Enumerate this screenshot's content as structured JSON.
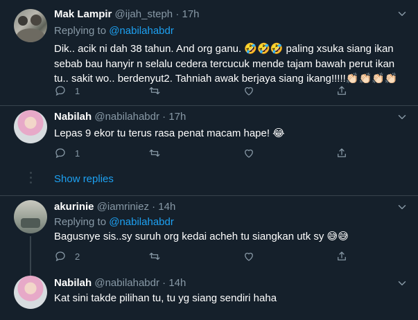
{
  "tweets": [
    {
      "name": "Mak Lampir",
      "handle": "@ijah_steph",
      "time": "· 17h",
      "replying_prefix": "Replying to ",
      "replying_handle": "@nabilahabdr",
      "text_lines": [
        "Dik.. acik ni dah 38 tahun. And org ganu. 🤣🤣🤣 paling xsuka siang ikan",
        "sebab bau hanyir n selalu cedera tercucuk mende tajam bawah perut ikan",
        "tu.. sakit wo.. berdenyut2. Tahniah awak berjaya siang ikang!!!!!👏🏻👏🏻👏🏻👏🏻"
      ],
      "reply_count": "1",
      "retweet_count": "",
      "like_count": ""
    },
    {
      "name": "Nabilah",
      "handle": "@nabilahabdr",
      "time": "· 17h",
      "text_lines": [
        "Lepas 9 ekor tu terus rasa penat macam hape! 😂"
      ],
      "reply_count": "1",
      "retweet_count": "",
      "like_count": ""
    },
    {
      "name": "akurinie",
      "handle": "@iamriniez",
      "time": "· 14h",
      "replying_prefix": "Replying to ",
      "replying_handle": "@nabilahabdr",
      "text_lines": [
        "Bagusnye sis..sy suruh org kedai acheh tu siangkan utk sy 😅😅"
      ],
      "reply_count": "2",
      "retweet_count": "",
      "like_count": ""
    },
    {
      "name": "Nabilah",
      "handle": "@nabilahabdr",
      "time": "· 14h",
      "text_lines": [
        "Kat sini takde pilihan tu, tu yg siang sendiri haha"
      ]
    }
  ],
  "show_replies": "Show replies",
  "icons": {
    "reply": "reply-icon",
    "retweet": "retweet-icon",
    "like": "heart-icon",
    "share": "share-icon",
    "more": "chevron-down-icon"
  },
  "colors": {
    "background": "#15202b",
    "secondary_text": "#8899a6",
    "link": "#1da1f2",
    "divider": "#38444d"
  }
}
